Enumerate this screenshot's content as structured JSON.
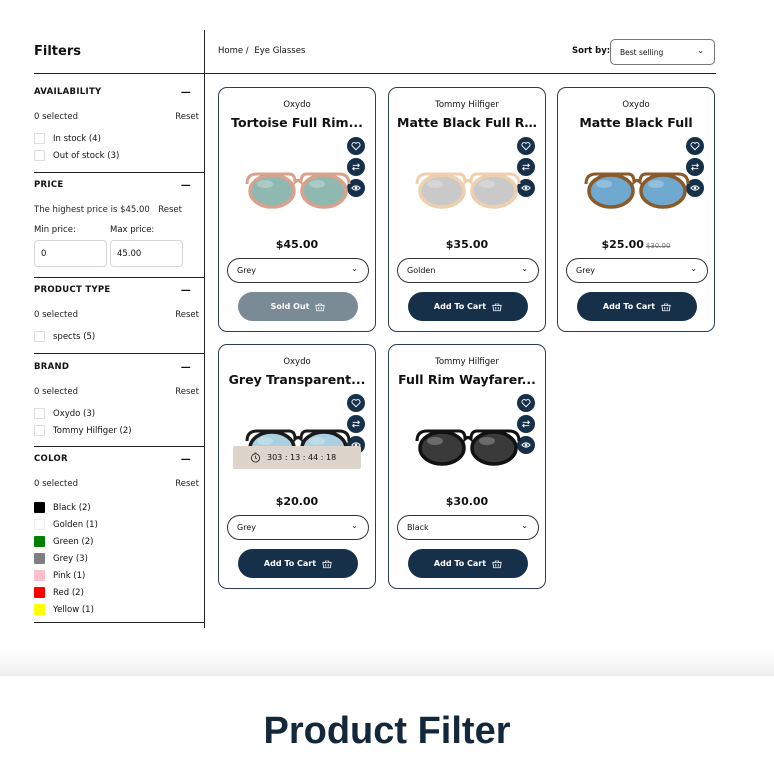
{
  "sidebar": {
    "title": "Filters",
    "availability": {
      "heading": "AVAILABILITY",
      "selected": "0 selected",
      "reset": "Reset",
      "options": [
        "In stock (4)",
        "Out of stock (3)"
      ]
    },
    "price": {
      "heading": "PRICE",
      "highest": "The highest price is $45.00",
      "reset": "Reset",
      "min_label": "Min price:",
      "max_label": "Max price:",
      "min_value": "0",
      "max_value": "45.00"
    },
    "product_type": {
      "heading": "PRODUCT TYPE",
      "selected": "0 selected",
      "reset": "Reset",
      "options": [
        "spects (5)"
      ]
    },
    "brand": {
      "heading": "BRAND",
      "selected": "0 selected",
      "reset": "Reset",
      "options": [
        "Oxydo (3)",
        "Tommy Hilfiger (2)"
      ]
    },
    "color": {
      "heading": "COLOR",
      "selected": "0 selected",
      "reset": "Reset",
      "options": [
        {
          "label": "Black (2)",
          "swatch": "#000000"
        },
        {
          "label": "Golden (1)",
          "swatch": "#ffffff"
        },
        {
          "label": "Green (2)",
          "swatch": "#008000"
        },
        {
          "label": "Grey (3)",
          "swatch": "#808080"
        },
        {
          "label": "Pink (1)",
          "swatch": "#ffc0cb"
        },
        {
          "label": "Red (2)",
          "swatch": "#ff0000"
        },
        {
          "label": "Yellow (1)",
          "swatch": "#ffff00"
        }
      ]
    }
  },
  "topbar": {
    "breadcrumb_home": "Home /",
    "breadcrumb_current": "Eye Glasses",
    "sort_label": "Sort by:",
    "sort_value": "Best selling"
  },
  "products": [
    {
      "brand": "Oxydo",
      "name": "Tortoise Full Rim...",
      "price": "$45.00",
      "old_price": "",
      "variant": "Grey",
      "button": "Sold Out",
      "sold_out": true,
      "lens": "#8fb8b0",
      "frame": "#d9a28c"
    },
    {
      "brand": "Tommy Hilfiger",
      "name": "Matte Black Full Ri...",
      "price": "$35.00",
      "old_price": "",
      "variant": "Golden",
      "button": "Add To Cart",
      "sold_out": false,
      "lens": "#c9c9c9",
      "frame": "#f0cfae"
    },
    {
      "brand": "Oxydo",
      "name": "Matte Black Full",
      "price": "$25.00",
      "old_price": "$30.00",
      "variant": "Grey",
      "button": "Add To Cart",
      "sold_out": false,
      "lens": "#6fa9cf",
      "frame": "#8a5a2b"
    },
    {
      "brand": "Oxydo",
      "name": "Grey Transparent...",
      "price": "$20.00",
      "old_price": "",
      "variant": "Grey",
      "button": "Add To Cart",
      "sold_out": false,
      "lens": "#a9cfe0",
      "frame": "#1a1a1a",
      "timer": "303  :  13  :  44  :  18"
    },
    {
      "brand": "Tommy Hilfiger",
      "name": "Full Rim Wayfarer...",
      "price": "$30.00",
      "old_price": "",
      "variant": "Black",
      "button": "Add To Cart",
      "sold_out": false,
      "lens": "#3a3a3a",
      "frame": "#111111"
    }
  ],
  "banner": {
    "title": "Product Filter"
  },
  "colors": {
    "primary": "#17304a",
    "sold_out": "#7b8b95",
    "timer_bg": "#ddd4cb"
  }
}
